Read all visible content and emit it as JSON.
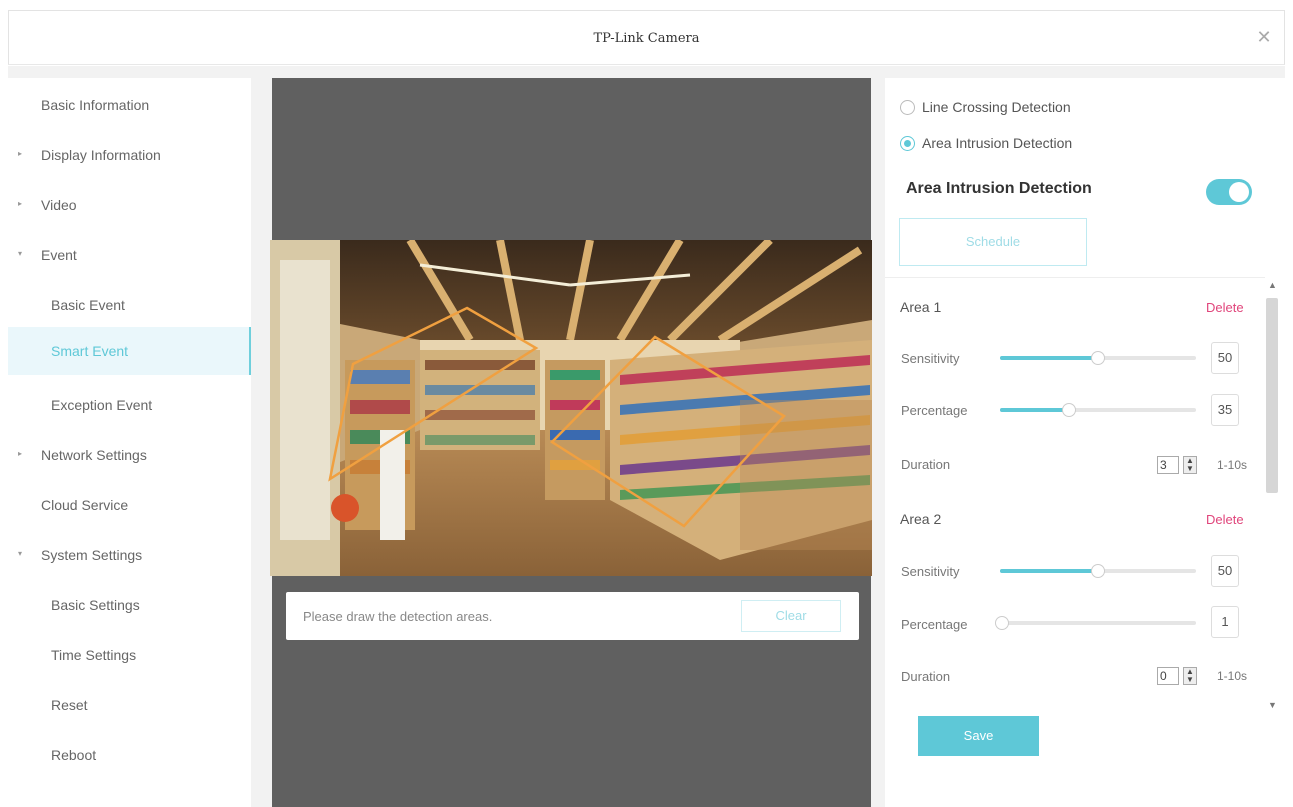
{
  "window": {
    "title": "TP-Link Camera",
    "close_icon": "close-icon"
  },
  "sidebar": {
    "items": [
      {
        "label": "Basic Information",
        "level": "top",
        "arrow": ""
      },
      {
        "label": "Display Information",
        "level": "top",
        "arrow": "▸"
      },
      {
        "label": "Video",
        "level": "top",
        "arrow": "▸"
      },
      {
        "label": "Event",
        "level": "top",
        "arrow": "▾"
      },
      {
        "label": "Basic Event",
        "level": "sub",
        "arrow": ""
      },
      {
        "label": "Smart Event",
        "level": "sub",
        "arrow": "",
        "active": true
      },
      {
        "label": "Exception Event",
        "level": "sub",
        "arrow": ""
      },
      {
        "label": "Network Settings",
        "level": "top",
        "arrow": "▸"
      },
      {
        "label": "Cloud Service",
        "level": "top",
        "arrow": ""
      },
      {
        "label": "System Settings",
        "level": "top",
        "arrow": "▾"
      },
      {
        "label": "Basic Settings",
        "level": "sub",
        "arrow": ""
      },
      {
        "label": "Time Settings",
        "level": "sub",
        "arrow": ""
      },
      {
        "label": "Reset",
        "level": "sub",
        "arrow": ""
      },
      {
        "label": "Reboot",
        "level": "sub",
        "arrow": ""
      }
    ]
  },
  "video": {
    "hint": "Please draw the detection areas.",
    "clear_label": "Clear"
  },
  "detection": {
    "options": [
      {
        "label": "Line Crossing Detection",
        "selected": false
      },
      {
        "label": "Area Intrusion Detection",
        "selected": true
      }
    ],
    "section_title": "Area Intrusion Detection",
    "enabled": true,
    "schedule_label": "Schedule",
    "areas": [
      {
        "title": "Area 1",
        "delete_label": "Delete",
        "sensitivity_label": "Sensitivity",
        "sensitivity": "50",
        "percentage_label": "Percentage",
        "percentage": "35",
        "duration_label": "Duration",
        "duration": "3",
        "duration_range": "1-10s"
      },
      {
        "title": "Area 2",
        "delete_label": "Delete",
        "sensitivity_label": "Sensitivity",
        "sensitivity": "50",
        "percentage_label": "Percentage",
        "percentage": "1",
        "duration_label": "Duration",
        "duration": "0",
        "duration_range": "1-10s"
      }
    ],
    "save_label": "Save"
  },
  "colors": {
    "accent": "#5ec8d7",
    "delete": "#e0457b",
    "detection_outline": "#f0a040",
    "video_bg": "#606060"
  }
}
